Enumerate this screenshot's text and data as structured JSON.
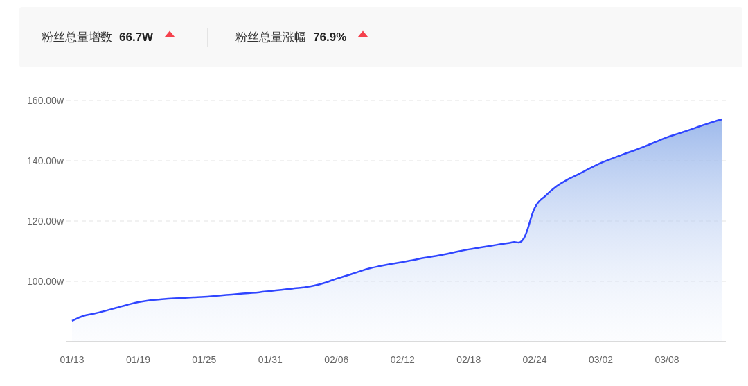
{
  "stats": [
    {
      "label": "粉丝总量增数",
      "value": "66.7W",
      "kind": "up"
    },
    {
      "label": "粉丝总量涨幅",
      "value": "76.9%",
      "kind": "up"
    }
  ],
  "chart": {
    "chart_data": {
      "type": "area",
      "ylim": [
        80,
        160
      ],
      "grid": true,
      "yticks": [
        {
          "value": 100,
          "label": "100.00w"
        },
        {
          "value": 120,
          "label": "120.00w"
        },
        {
          "value": 140,
          "label": "140.00w"
        },
        {
          "value": 160,
          "label": "160.00w"
        }
      ],
      "categories": [
        "01/13",
        null,
        null,
        null,
        null,
        null,
        "01/19",
        null,
        null,
        null,
        null,
        null,
        "01/25",
        null,
        null,
        null,
        null,
        null,
        "01/31",
        null,
        null,
        null,
        null,
        null,
        "02/06",
        null,
        null,
        null,
        null,
        null,
        "02/12",
        null,
        null,
        null,
        null,
        null,
        "02/18",
        null,
        null,
        null,
        null,
        null,
        "02/24",
        null,
        null,
        null,
        null,
        null,
        "03/02",
        null,
        null,
        null,
        null,
        null,
        "03/08",
        null,
        null,
        null,
        null,
        null
      ],
      "series": [
        {
          "color": "#2f45ff",
          "values": [
            86.9,
            88.5,
            89.3,
            90.2,
            91.2,
            92.2,
            93.1,
            93.7,
            94.0,
            94.3,
            94.5,
            94.7,
            94.9,
            95.2,
            95.5,
            95.8,
            96.1,
            96.4,
            96.8,
            97.2,
            97.6,
            98.0,
            98.6,
            99.6,
            100.9,
            102.0,
            103.2,
            104.3,
            105.1,
            105.8,
            106.4,
            107.1,
            107.8,
            108.4,
            109.1,
            109.9,
            110.6,
            111.2,
            111.8,
            112.4,
            113.0,
            114.2,
            124.4,
            128.5,
            131.6,
            133.8,
            135.6,
            137.5,
            139.3,
            140.7,
            142.1,
            143.4,
            144.8,
            146.3,
            147.8,
            149.0,
            150.2,
            151.5,
            152.7,
            153.8
          ]
        }
      ]
    }
  }
}
